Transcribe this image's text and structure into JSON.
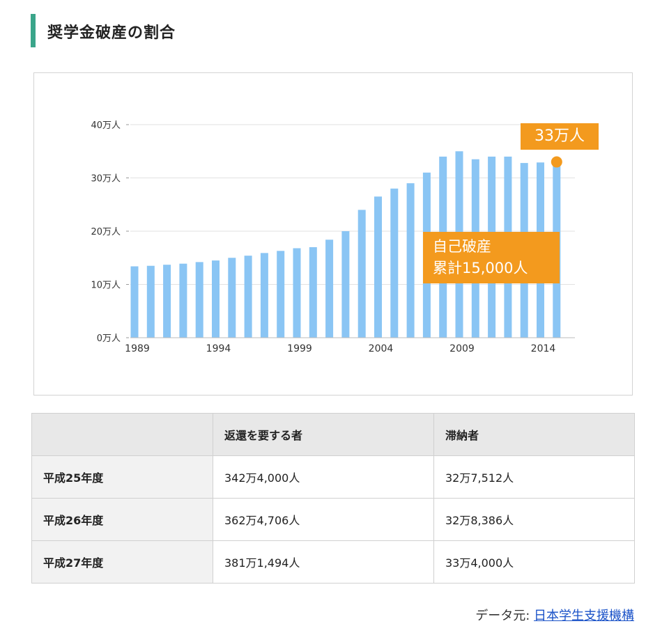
{
  "heading": {
    "title": "奨学金破産の割合"
  },
  "chart_data": {
    "type": "bar",
    "categories": [
      "1989",
      "1990",
      "1991",
      "1992",
      "1993",
      "1994",
      "1995",
      "1996",
      "1997",
      "1998",
      "1999",
      "2000",
      "2001",
      "2002",
      "2003",
      "2004",
      "2005",
      "2006",
      "2007",
      "2008",
      "2009",
      "2010",
      "2011",
      "2012",
      "2013",
      "2014",
      "2015"
    ],
    "x_tick_labels": [
      "1989",
      "1994",
      "1999",
      "2004",
      "2009",
      "2014"
    ],
    "values": [
      13.4,
      13.5,
      13.7,
      13.9,
      14.2,
      14.5,
      15.0,
      15.4,
      15.9,
      16.3,
      16.8,
      17.0,
      18.4,
      20.0,
      24.0,
      26.5,
      28.0,
      29.0,
      31.0,
      34.0,
      35.0,
      33.5,
      34.0,
      34.0,
      32.8,
      32.9,
      33.0
    ],
    "y_ticks": [
      "0万人",
      "10万人",
      "20万人",
      "30万人",
      "40万人"
    ],
    "ylim": [
      0,
      40
    ],
    "bar_color": "#8ac5f4",
    "accent_color": "#f39a1e",
    "marker_label": "33万人",
    "annotation_lines": [
      "自己破産",
      "累計15,000人"
    ]
  },
  "table": {
    "headers": [
      "",
      "返還を要する者",
      "滞納者"
    ],
    "rows": [
      [
        "平成25年度",
        "342万4,000人",
        "32万7,512人"
      ],
      [
        "平成26年度",
        "362万4,706人",
        "32万8,386人"
      ],
      [
        "平成27年度",
        "381万1,494人",
        "33万4,000人"
      ]
    ]
  },
  "source": {
    "label": "データ元: ",
    "link_text": "日本学生支援機構"
  }
}
